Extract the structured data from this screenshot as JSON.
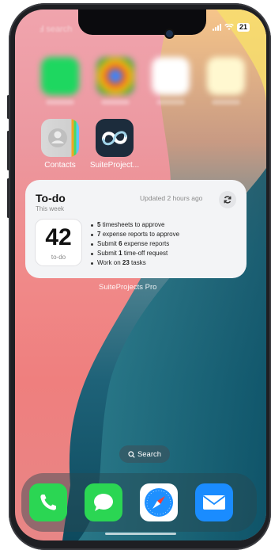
{
  "status_bar": {
    "left_text": "Ⅎ search",
    "battery": "21"
  },
  "apps": [
    {
      "label": "Contacts",
      "icon": "contacts-icon"
    },
    {
      "label": "SuiteProject...",
      "icon": "suiteprojects-icon"
    }
  ],
  "widget": {
    "title": "To-do",
    "subtitle": "This week",
    "updated": "Updated 2 hours ago",
    "count": "42",
    "count_label": "to-do",
    "items": [
      {
        "num": "5",
        "pre": "",
        "post": "timesheets to approve"
      },
      {
        "num": "7",
        "pre": "",
        "post": "expense reports to approve"
      },
      {
        "num": "6",
        "pre": "Submit",
        "post": "expense reports"
      },
      {
        "num": "1",
        "pre": "Submit",
        "post": "time-off request"
      },
      {
        "num": "23",
        "pre": "Work on",
        "post": "tasks"
      }
    ],
    "caption": "SuiteProjects Pro"
  },
  "search": {
    "label": "Search"
  },
  "dock": [
    {
      "name": "phone",
      "icon": "phone-icon",
      "color": "#2bd653"
    },
    {
      "name": "messages",
      "icon": "messages-icon",
      "color": "#2bd653"
    },
    {
      "name": "safari",
      "icon": "safari-icon",
      "color": "#1e90ff"
    },
    {
      "name": "mail",
      "icon": "mail-icon",
      "color": "#1a8cff"
    }
  ]
}
